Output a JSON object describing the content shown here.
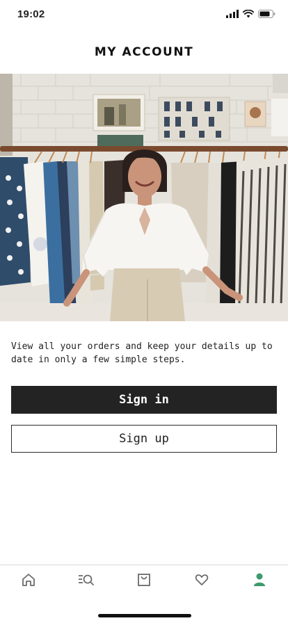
{
  "status_bar": {
    "time": "19:02",
    "icons": [
      "signal-icon",
      "wifi-icon",
      "battery-icon"
    ]
  },
  "header": {
    "title": "MY ACCOUNT"
  },
  "hero": {
    "image": "woman in white blouse standing between clothing racks in a boutique"
  },
  "intro": {
    "text": "View all your orders and keep your details up to date in only a few simple steps."
  },
  "actions": {
    "sign_in_label": "Sign in",
    "sign_up_label": "Sign up"
  },
  "tab_bar": {
    "items": [
      {
        "icon": "home-icon",
        "active": false
      },
      {
        "icon": "search-icon",
        "active": false
      },
      {
        "icon": "bag-icon",
        "active": false
      },
      {
        "icon": "heart-icon",
        "active": false
      },
      {
        "icon": "account-icon",
        "active": true
      }
    ],
    "active_color": "#3d9a6e",
    "inactive_color": "#6b6b6b"
  },
  "colors": {
    "primary_button": "#232323",
    "text": "#1f1f1f"
  }
}
